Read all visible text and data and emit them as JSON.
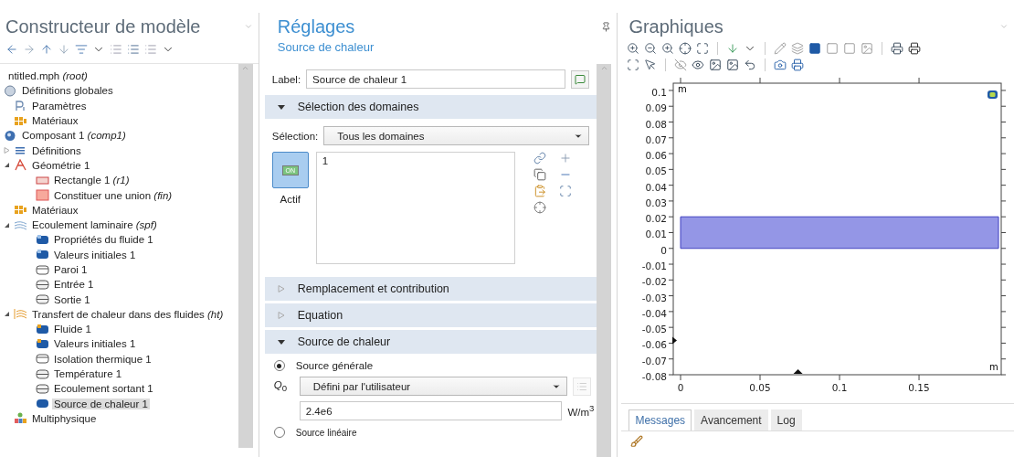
{
  "model_builder": {
    "title": "Constructeur de modèle",
    "tree": [
      {
        "label": "ntitled.mph *(root)*",
        "kind": "file",
        "selected": false
      },
      {
        "label": "Définitions globales",
        "kind": "globals",
        "selected": false,
        "children": [
          {
            "label": "Paramètres",
            "kind": "parameters",
            "selected": false
          },
          {
            "label": "Matériaux",
            "kind": "materials",
            "selected": false
          }
        ]
      },
      {
        "label": "Composant 1 *(comp1)*",
        "kind": "component",
        "selected": false,
        "children": [
          {
            "label": "Définitions",
            "kind": "definitions",
            "expanded": false,
            "selected": false
          },
          {
            "label": "Géométrie 1",
            "kind": "geometry",
            "expanded": true,
            "selected": false,
            "children": [
              {
                "label": "Rectangle 1 *(r1)*",
                "kind": "rectangle",
                "selected": false
              },
              {
                "label": "Constituer une union *(fin)*",
                "kind": "union",
                "selected": false
              }
            ]
          },
          {
            "label": "Matériaux",
            "kind": "materials",
            "selected": false
          },
          {
            "label": "Ecoulement laminaire *(spf)*",
            "kind": "flow",
            "expanded": true,
            "selected": false,
            "children": [
              {
                "label": "Propriétés du fluide 1",
                "kind": "domain",
                "selected": false
              },
              {
                "label": "Valeurs initiales 1",
                "kind": "domain",
                "selected": false
              },
              {
                "label": "Paroi 1",
                "kind": "wall",
                "selected": false
              },
              {
                "label": "Entrée 1",
                "kind": "boundary",
                "selected": false
              },
              {
                "label": "Sortie 1",
                "kind": "boundary",
                "selected": false
              }
            ]
          },
          {
            "label": "Transfert de chaleur dans des fluides *(ht)*",
            "kind": "heat",
            "expanded": true,
            "selected": false,
            "children": [
              {
                "label": "Fluide 1",
                "kind": "heat-domain",
                "selected": false
              },
              {
                "label": "Valeurs initiales 1",
                "kind": "heat-domain",
                "selected": false
              },
              {
                "label": "Isolation thermique 1",
                "kind": "wall",
                "selected": false
              },
              {
                "label": "Température 1",
                "kind": "boundary",
                "selected": false
              },
              {
                "label": "Ecoulement sortant 1",
                "kind": "boundary",
                "selected": false
              },
              {
                "label": "Source de chaleur 1",
                "kind": "source",
                "selected": true
              }
            ]
          },
          {
            "label": "Multiphysique",
            "kind": "multiphysics",
            "selected": false
          }
        ]
      }
    ]
  },
  "settings": {
    "title": "Réglages",
    "subtitle": "Source de chaleur",
    "label_field": {
      "label": "Label:",
      "value": "Source de chaleur 1"
    },
    "sections": [
      {
        "title": "Sélection des domaines",
        "expanded": true,
        "kind": "selection",
        "selection_label": "Sélection:",
        "selection_value": "Tous les domaines",
        "active_button": {
          "badge": "ON",
          "label": "Actif",
          "on": true
        },
        "domains": [
          "1"
        ]
      },
      {
        "title": "Remplacement et contribution",
        "expanded": false
      },
      {
        "title": "Equation",
        "expanded": false
      },
      {
        "title": "Source de chaleur",
        "expanded": true,
        "kind": "heat-source",
        "options": [
          {
            "label": "Source générale",
            "selected": true
          },
          {
            "label": "Source linéaire",
            "selected": false
          }
        ],
        "q_label": "*Q*$_{0}$",
        "q_value": "Défini par l'utilisateur",
        "definition_button": {
          "disabled": true
        },
        "value": "2.4e6",
        "unit": "W/m$^{3}$"
      }
    ]
  },
  "graphics": {
    "title": "Graphiques",
    "chart_data": {
      "type": "area",
      "xlabel": "m",
      "ylabel": "m",
      "x": [
        0,
        0.2
      ],
      "series": [
        {
          "color": "#9496e6",
          "values": [
            0.02,
            0.02
          ]
        }
      ],
      "xlim": [
        -0.0046,
        0.2017
      ],
      "ylim": [
        -0.08,
        0.1046
      ],
      "xticks": [
        0,
        0.05,
        0.1,
        0.15
      ],
      "yticks": [
        0.1,
        0.09,
        0.08,
        0.07,
        0.06,
        0.05,
        0.04,
        0.03,
        0.02,
        0.01,
        0,
        -0.01,
        -0.02,
        -0.03,
        -0.04,
        -0.05,
        -0.06,
        -0.07,
        -0.08
      ]
    }
  },
  "messages": {
    "tabs": [
      {
        "label": "Messages",
        "selected": true
      },
      {
        "label": "Avancement",
        "selected": false
      },
      {
        "label": "Log",
        "selected": false
      }
    ]
  }
}
